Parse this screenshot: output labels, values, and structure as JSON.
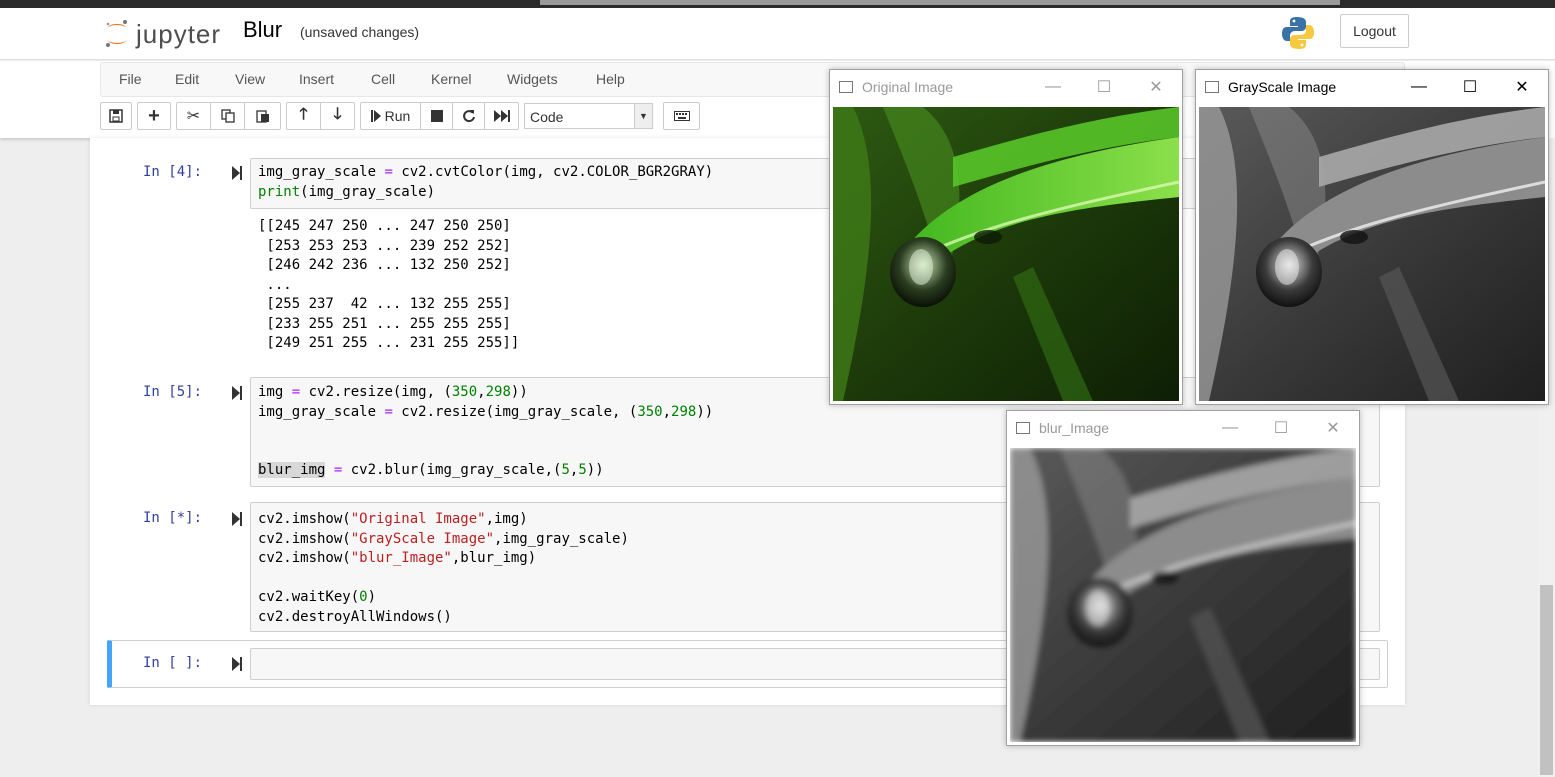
{
  "header": {
    "logo_text": "jupyter",
    "notebook_name": "Blur",
    "save_status": "(unsaved changes)",
    "logout_label": "Logout"
  },
  "menu": [
    "File",
    "Edit",
    "View",
    "Insert",
    "Cell",
    "Kernel",
    "Widgets",
    "Help"
  ],
  "toolbar": {
    "run_label": "Run",
    "cell_type": "Code",
    "icons": [
      "save-icon",
      "plus-icon",
      "scissors-icon",
      "copy-icon",
      "paste-icon",
      "arrow-up-icon",
      "arrow-down-icon",
      "run-icon",
      "stop-icon",
      "restart-icon",
      "fast-forward-icon",
      "keyboard-icon"
    ]
  },
  "cells": {
    "c4": {
      "prompt": "In [4]:",
      "output": [
        "[[245 247 250 ... 247 250 250]",
        " [253 253 253 ... 239 252 252]",
        " [246 242 236 ... 132 250 252]",
        " ...",
        " [255 237  42 ... 132 255 255]",
        " [233 255 251 ... 255 255 255]",
        " [249 251 255 ... 231 255 255]]"
      ]
    },
    "c5": {
      "prompt": "In [5]:"
    },
    "c6": {
      "prompt": "In [*]:"
    },
    "c7": {
      "prompt": "In [ ]:"
    }
  },
  "windows": {
    "original": {
      "title": "Original Image"
    },
    "grayscale": {
      "title": "GrayScale Image"
    },
    "blur": {
      "title": "blur_Image"
    }
  },
  "colors": {
    "prompt": "#303f9f",
    "keyword_green": "#008000",
    "string_red": "#ba2121",
    "operator_purple": "#aa22ff",
    "active_cell_blue": "#42a5f5",
    "leaf_green": "#3fb51e"
  }
}
